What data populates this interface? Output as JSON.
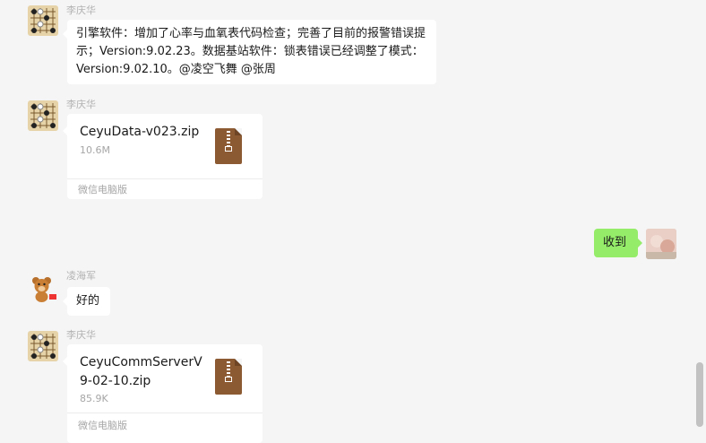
{
  "messages": [
    {
      "sender": "李庆华",
      "text": "引擎软件：增加了心率与血氧表代码检查；完善了目前的报警错误提示；Version:9.02.23。数据基站软件：锁表错误已经调整了模式：Version:9.02.10。@凌空飞舞 @张周"
    },
    {
      "sender": "李庆华",
      "file_name": "CeyuData-v023.zip",
      "file_size": "10.6M",
      "source": "微信电脑版",
      "icon": "zip-file-icon"
    },
    {
      "text": "收到",
      "from_me": true
    },
    {
      "sender": "凌海军",
      "text": "好的"
    },
    {
      "sender": "李庆华",
      "file_name": "CeyuCommServerV9-02-10.zip",
      "file_size": "85.9K",
      "source": "微信电脑版",
      "icon": "zip-file-icon"
    }
  ],
  "colors": {
    "background": "#f5f5f5",
    "incoming_bubble": "#ffffff",
    "outgoing_bubble": "#95ec69",
    "zip_icon": "#8c5a32"
  }
}
